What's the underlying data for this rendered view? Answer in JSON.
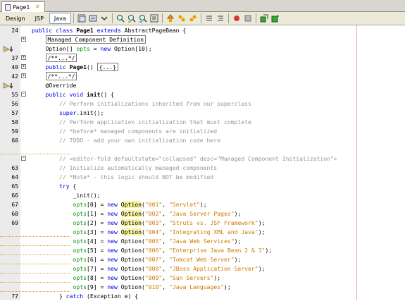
{
  "file_tab": {
    "name": "Page1",
    "close": "×"
  },
  "view_tabs": [
    "Design",
    "JSP",
    "Java"
  ],
  "active_view": "Java",
  "toolbar_icons": [
    "history-icon",
    "back-icon",
    "forward-icon",
    "find-icon",
    "find-prev-icon",
    "find-next-icon",
    "toggle-highlight-icon",
    "shift-left-icon",
    "shift-right-icon",
    "comment-icon",
    "uncomment-icon",
    "stop-macro-icon",
    "record-macro-icon",
    "run-icon",
    "add-icon"
  ],
  "colors": {
    "keyword": "#0000e6",
    "comment": "#969696",
    "string": "#ce7b00",
    "field": "#009900",
    "highlight": "#f8f4a0"
  },
  "lines": [
    {
      "num": "24",
      "fold": "",
      "glyph": "",
      "tokens": [
        [
          "kw",
          "public class "
        ],
        [
          "cls",
          "Page1 "
        ],
        [
          "kw",
          "extends "
        ],
        [
          "",
          "AbstractPageBean {"
        ]
      ]
    },
    {
      "num": "",
      "fold": "+",
      "glyph": "",
      "tokens": [
        [
          "",
          "    "
        ],
        [
          "boxed",
          "Managed Component Definition"
        ]
      ]
    },
    {
      "num": "",
      "fold": "",
      "glyph": "bookmark",
      "tokens": [
        [
          "",
          "    Option[] "
        ],
        [
          "fd",
          "opts"
        ],
        [
          "",
          " = "
        ],
        [
          "kw",
          "new "
        ],
        [
          "",
          "Option[10];"
        ]
      ]
    },
    {
      "num": "37",
      "fold": "+",
      "glyph": "",
      "tokens": [
        [
          "",
          "    "
        ],
        [
          "boxed",
          "/**...*/"
        ]
      ]
    },
    {
      "num": "40",
      "fold": "+",
      "glyph": "",
      "tokens": [
        [
          "",
          "    "
        ],
        [
          "kw",
          "public "
        ],
        [
          "cls",
          "Page1"
        ],
        [
          "",
          "() "
        ],
        [
          "boxed",
          "{...}"
        ]
      ]
    },
    {
      "num": "42",
      "fold": "+",
      "glyph": "",
      "tokens": [
        [
          "",
          "    "
        ],
        [
          "boxed",
          "/**...*/"
        ]
      ]
    },
    {
      "num": "",
      "fold": "",
      "glyph": "bookmark",
      "tokens": [
        [
          "",
          "    @Override"
        ]
      ]
    },
    {
      "num": "55",
      "fold": "-",
      "glyph": "",
      "tokens": [
        [
          "",
          "    "
        ],
        [
          "kw",
          "public void "
        ],
        [
          "cls",
          "init"
        ],
        [
          "",
          "() {"
        ]
      ]
    },
    {
      "num": "56",
      "fold": "",
      "glyph": "",
      "tokens": [
        [
          "cm",
          "        // Perform initializations inherited from our superclass"
        ]
      ]
    },
    {
      "num": "57",
      "fold": "",
      "glyph": "",
      "tokens": [
        [
          "",
          "        "
        ],
        [
          "kw",
          "super"
        ],
        [
          "",
          ".init();"
        ]
      ]
    },
    {
      "num": "58",
      "fold": "",
      "glyph": "",
      "tokens": [
        [
          "cm",
          "        // Perform application initialization that must complete"
        ]
      ]
    },
    {
      "num": "59",
      "fold": "",
      "glyph": "",
      "tokens": [
        [
          "cm",
          "        // *before* managed components are initialized"
        ]
      ]
    },
    {
      "num": "60",
      "fold": "",
      "glyph": "",
      "tokens": [
        [
          "cm",
          "        // TODO - add your own initialization code here"
        ]
      ]
    },
    {
      "num": "",
      "fold": "",
      "glyph": "uline",
      "tokens": [
        [
          "",
          ""
        ]
      ]
    },
    {
      "num": "",
      "fold": "-",
      "glyph": "",
      "tokens": [
        [
          "cm",
          "        // <editor-fold defaultstate=\"collapsed\" desc=\"Managed Component Initialization\">"
        ]
      ]
    },
    {
      "num": "63",
      "fold": "",
      "glyph": "",
      "tokens": [
        [
          "cm",
          "        // Initialize automatically managed components"
        ]
      ]
    },
    {
      "num": "64",
      "fold": "",
      "glyph": "",
      "tokens": [
        [
          "cm",
          "        // *Note* - this logic should NOT be modified"
        ]
      ]
    },
    {
      "num": "65",
      "fold": "",
      "glyph": "",
      "tokens": [
        [
          "",
          "        "
        ],
        [
          "kw",
          "try "
        ],
        [
          "",
          "{"
        ]
      ]
    },
    {
      "num": "66",
      "fold": "",
      "glyph": "",
      "tokens": [
        [
          "",
          "            _init();"
        ]
      ]
    },
    {
      "num": "67",
      "fold": "",
      "glyph": "",
      "tokens": [
        [
          "",
          "            "
        ],
        [
          "fd",
          "opts"
        ],
        [
          "",
          "[0] = "
        ],
        [
          "kw",
          "new "
        ],
        [
          "hl",
          "Option"
        ],
        [
          "",
          "("
        ],
        [
          "st",
          "\"001\""
        ],
        [
          "",
          ", "
        ],
        [
          "st",
          "\"Servlet\""
        ],
        [
          "",
          ");"
        ]
      ]
    },
    {
      "num": "68",
      "fold": "",
      "glyph": "",
      "tokens": [
        [
          "",
          "            "
        ],
        [
          "fd",
          "opts"
        ],
        [
          "",
          "[1] = "
        ],
        [
          "kw",
          "new "
        ],
        [
          "hl",
          "Option"
        ],
        [
          "",
          "("
        ],
        [
          "st",
          "\"002\""
        ],
        [
          "",
          ", "
        ],
        [
          "st",
          "\"Java Server Pages\""
        ],
        [
          "",
          ");"
        ]
      ]
    },
    {
      "num": "69",
      "fold": "",
      "glyph": "",
      "tokens": [
        [
          "",
          "            "
        ],
        [
          "fd",
          "opts"
        ],
        [
          "",
          "[2] = "
        ],
        [
          "kw",
          "new "
        ],
        [
          "hl",
          "Option"
        ],
        [
          "",
          "("
        ],
        [
          "st",
          "\"003\""
        ],
        [
          "",
          ", "
        ],
        [
          "st",
          "\"Struts vs. JSF Framework\""
        ],
        [
          "",
          ");"
        ]
      ]
    },
    {
      "num": "",
      "fold": "",
      "glyph": "uline",
      "tokens": [
        [
          "",
          "            "
        ],
        [
          "fd",
          "opts"
        ],
        [
          "",
          "[3] = "
        ],
        [
          "kw",
          "new "
        ],
        [
          "hl",
          "Option"
        ],
        [
          "",
          "("
        ],
        [
          "st",
          "\"004\""
        ],
        [
          "",
          ", "
        ],
        [
          "st",
          "\"Integrating XML and Java\""
        ],
        [
          "",
          ");"
        ]
      ]
    },
    {
      "num": "",
      "fold": "",
      "glyph": "uline",
      "tokens": [
        [
          "",
          "            "
        ],
        [
          "fd",
          "opts"
        ],
        [
          "",
          "[4] = "
        ],
        [
          "kw",
          "new "
        ],
        [
          "",
          "Option("
        ],
        [
          "st",
          "\"005\""
        ],
        [
          "",
          ", "
        ],
        [
          "st",
          "\"Java Web Services\""
        ],
        [
          "",
          ");"
        ]
      ]
    },
    {
      "num": "",
      "fold": "",
      "glyph": "uline",
      "tokens": [
        [
          "",
          "            "
        ],
        [
          "fd",
          "opts"
        ],
        [
          "",
          "[5] = "
        ],
        [
          "kw",
          "new "
        ],
        [
          "",
          "Option("
        ],
        [
          "st",
          "\"006\""
        ],
        [
          "",
          ", "
        ],
        [
          "st",
          "\"Enterprise Java Bean 2 & 3\""
        ],
        [
          "",
          ");"
        ]
      ]
    },
    {
      "num": "",
      "fold": "",
      "glyph": "uline",
      "tokens": [
        [
          "",
          "            "
        ],
        [
          "fd",
          "opts"
        ],
        [
          "",
          "[6] = "
        ],
        [
          "kw",
          "new "
        ],
        [
          "",
          "Option("
        ],
        [
          "st",
          "\"007\""
        ],
        [
          "",
          ", "
        ],
        [
          "st",
          "\"Tomcat Web Server\""
        ],
        [
          "",
          ");"
        ]
      ]
    },
    {
      "num": "",
      "fold": "",
      "glyph": "uline",
      "tokens": [
        [
          "",
          "            "
        ],
        [
          "fd",
          "opts"
        ],
        [
          "",
          "[7] = "
        ],
        [
          "kw",
          "new "
        ],
        [
          "",
          "Option("
        ],
        [
          "st",
          "\"008\""
        ],
        [
          "",
          ", "
        ],
        [
          "st",
          "\"JBoss Application Server\""
        ],
        [
          "",
          ");"
        ]
      ]
    },
    {
      "num": "",
      "fold": "",
      "glyph": "uline",
      "tokens": [
        [
          "",
          "            "
        ],
        [
          "fd",
          "opts"
        ],
        [
          "",
          "[8] = "
        ],
        [
          "kw",
          "new "
        ],
        [
          "",
          "Option("
        ],
        [
          "st",
          "\"009\""
        ],
        [
          "",
          ", "
        ],
        [
          "st",
          "\"Sun Servers\""
        ],
        [
          "",
          ");"
        ]
      ]
    },
    {
      "num": "",
      "fold": "",
      "glyph": "uline",
      "tokens": [
        [
          "",
          "            "
        ],
        [
          "fd",
          "opts"
        ],
        [
          "",
          "[9] = "
        ],
        [
          "kw",
          "new "
        ],
        [
          "",
          "Option("
        ],
        [
          "st",
          "\"010\""
        ],
        [
          "",
          ", "
        ],
        [
          "st",
          "\"Java Languages\""
        ],
        [
          "",
          ");"
        ]
      ]
    },
    {
      "num": "77",
      "fold": "",
      "glyph": "",
      "tokens": [
        [
          "",
          "        } "
        ],
        [
          "kw",
          "catch "
        ],
        [
          "",
          "(Exception e) {"
        ]
      ]
    }
  ]
}
